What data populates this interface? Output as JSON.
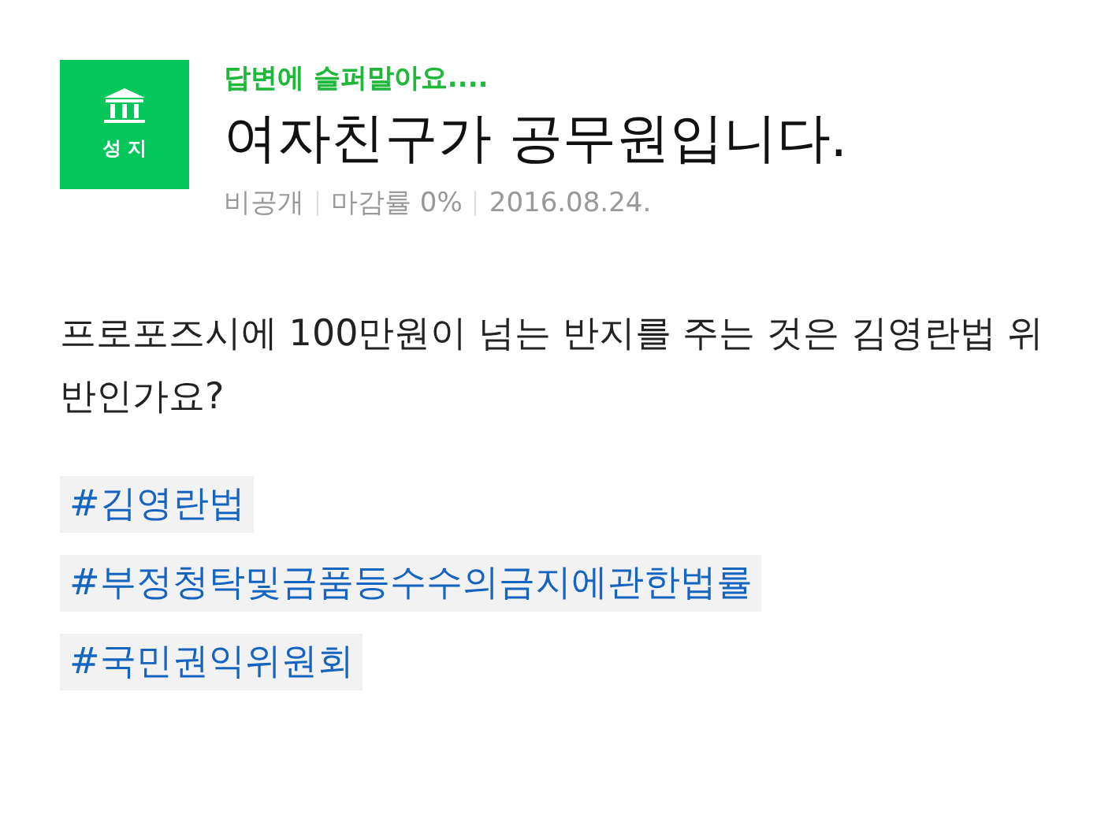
{
  "badge": {
    "label": "성 지"
  },
  "subtitle": "답변에 슬퍼말아요....",
  "title": "여자친구가 공무원입니다.",
  "meta": [
    "비공개",
    "마감률 0%",
    "2016.08.24."
  ],
  "body": "프로포즈시에 100만원이 넘는 반지를 주는 것은 김영란법 위반인가요?",
  "tags": [
    "#김영란법",
    "#부정청탁및금품등수수의금지에관한법률",
    "#국민권익위원회"
  ]
}
